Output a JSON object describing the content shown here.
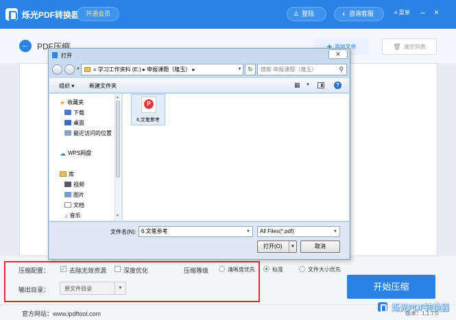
{
  "app": {
    "title": "烁光PDF转换器",
    "vip_label": "开通会员",
    "login_label": "登陆",
    "service_label": "咨询客服",
    "menu_label": "≡  菜单",
    "minimize_label": "–",
    "close_label": "×"
  },
  "page": {
    "back_label": "←",
    "title": "PDF压缩",
    "add_file_label": "添加文件",
    "clear_list_label": "清空列表"
  },
  "settings": {
    "compress_config_label": "压缩配置：",
    "remove_invalid_label": "去除无效资源",
    "remove_invalid_checked": true,
    "deep_optimize_label": "深度优化",
    "deep_optimize_checked": false,
    "level_label": "压缩等级",
    "levels": [
      {
        "label": "清晰度优先",
        "selected": false
      },
      {
        "label": "标准",
        "selected": true
      },
      {
        "label": "文件大小优先",
        "selected": false
      }
    ],
    "output_dir_label": "输出目录：",
    "output_dir_value": "原文件目录",
    "start_label": "开始压缩"
  },
  "footer": {
    "website": "官方网站：www.ipdftool.com",
    "version": "版本：1.1.7.0",
    "watermark": "烁光PDF转换器"
  },
  "dialog": {
    "title": "打开",
    "close_label": "✕",
    "path_prefix": "«",
    "path": "学习工作资料 (E:) ▸ 申报课题（隆玉） ▸",
    "search_placeholder": "搜索 申报课题（隆玉）",
    "organize_label": "组织 ▾",
    "new_folder_label": "新建文件夹",
    "nav": {
      "favorites": "收藏夹",
      "downloads": "下载",
      "desktop": "桌面",
      "recent": "最近访问的位置",
      "wps": "WPS网盘",
      "library": "库",
      "videos": "视频",
      "pictures": "图片",
      "documents": "文档",
      "music": "音乐"
    },
    "file_name": "6.文笔参考",
    "filename_label": "文件名(N):",
    "filename_value": "6.文笔参考",
    "filetype_value": "All Files(*.pdf)",
    "open_label": "打开(O)",
    "cancel_label": "取消"
  },
  "colors": {
    "primary": "#2a82e4",
    "highlight_border": "#e0282f"
  }
}
